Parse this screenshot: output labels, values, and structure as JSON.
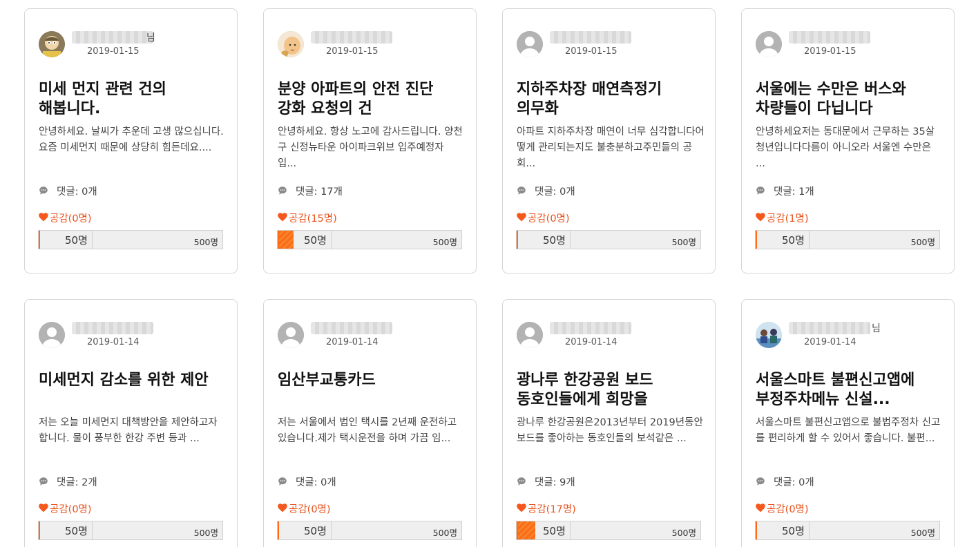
{
  "colors": {
    "accent": "#e8521c",
    "bar_fill": "#ff6a13",
    "border": "#d6d6d6"
  },
  "posts": [
    {
      "author_suffix": "님",
      "avatar_icon": "cartoon-character-avatar",
      "date": "2019-01-15",
      "title": "미세 먼지 관련 건의 해봅니다.",
      "excerpt": "안녕하세요. 날씨가 추운데 고생 많으십니다.요즘 미세먼지 때문에 상당히 힘든데요....",
      "comments": "댓글: 0개",
      "likes": "공감(0명)",
      "like_count": 0,
      "goal_mark": "50명",
      "goal_max": "500명"
    },
    {
      "author_suffix": "",
      "avatar_icon": "baby-photo-avatar",
      "date": "2019-01-15",
      "title": "분양 아파트의 안전 진단 강화 요청의 건",
      "excerpt": "안녕하세요. 항상 노고에 감사드립니다. 양천구 신정뉴타운 아이파크위브 입주예정자 입...",
      "comments": "댓글: 17개",
      "likes": "공감(15명)",
      "like_count": 15,
      "goal_mark": "50명",
      "goal_max": "500명"
    },
    {
      "author_suffix": "",
      "avatar_icon": "default-user-avatar",
      "date": "2019-01-15",
      "title": "지하주차장 매연측정기 의무화",
      "excerpt": "아파트 지하주차장 매연이 너무 심각합니다어떻게 관리되는지도 불충분하고주민들의 공회...",
      "comments": "댓글: 0개",
      "likes": "공감(0명)",
      "like_count": 0,
      "goal_mark": "50명",
      "goal_max": "500명"
    },
    {
      "author_suffix": "",
      "avatar_icon": "default-user-avatar",
      "date": "2019-01-15",
      "title": "서울에는 수만은 버스와 차량들이 다닙니다",
      "excerpt": "안녕하세요저는 동대문에서 근무하는 35살 청년입니다다름이 아니오라 서울엔 수만은 ...",
      "comments": "댓글: 1개",
      "likes": "공감(1명)",
      "like_count": 1,
      "goal_mark": "50명",
      "goal_max": "500명"
    },
    {
      "author_suffix": "",
      "avatar_icon": "default-user-avatar",
      "date": "2019-01-14",
      "title": "미세먼지 감소를 위한 제안",
      "excerpt": "저는 오늘 미세먼지 대책방안을 제안하고자 합니다. 물이 풍부한 한강 주변 등과 ...",
      "comments": "댓글: 2개",
      "likes": "공감(0명)",
      "like_count": 0,
      "goal_mark": "50명",
      "goal_max": "500명"
    },
    {
      "author_suffix": "",
      "avatar_icon": "default-user-avatar",
      "date": "2019-01-14",
      "title": "임산부교통카드",
      "excerpt": "저는 서울에서 법인 택시를 2년째 운전하고 있습니다.제가 택시운전을 하며 가끔 임...",
      "comments": "댓글: 0개",
      "likes": "공감(0명)",
      "like_count": 0,
      "goal_mark": "50명",
      "goal_max": "500명"
    },
    {
      "author_suffix": "",
      "avatar_icon": "default-user-avatar",
      "date": "2019-01-14",
      "title": "광나루 한강공원 보드 동호인들에게 희망을",
      "excerpt": "광나루 한강공원은2013년부터 2019년동안 보드를 좋아하는 동호인들의 보석같은 ...",
      "comments": "댓글: 9개",
      "likes": "공감(17명)",
      "like_count": 17,
      "goal_mark": "50명",
      "goal_max": "500명"
    },
    {
      "author_suffix": "님",
      "avatar_icon": "group-photo-avatar",
      "date": "2019-01-14",
      "title": "서울스마트 불편신고앱에 부정주차메뉴 신설...",
      "excerpt": "서울스마트 불편신고앱으로 불법주정차 신고를 편리하게 할 수 있어서 좋습니다. 불편...",
      "comments": "댓글: 0개",
      "likes": "공감(0명)",
      "like_count": 0,
      "goal_mark": "50명",
      "goal_max": "500명"
    }
  ]
}
